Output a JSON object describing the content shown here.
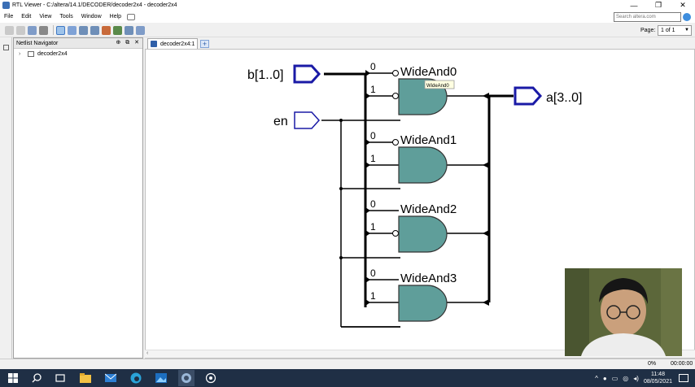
{
  "window": {
    "title": "RTL Viewer - C:/altera/14.1/DECODER/decoder2x4 - decoder2x4",
    "minimize": "—",
    "maximize": "❐",
    "close": "✕"
  },
  "menu": {
    "items": [
      "File",
      "Edit",
      "View",
      "Tools",
      "Window",
      "Help"
    ]
  },
  "search": {
    "placeholder": "Search altera.com"
  },
  "toolbar": {
    "page_label": "Page:",
    "page_value": "1 of 1"
  },
  "navigator": {
    "title": "Netlist Navigator",
    "controls": "⊕ ⧉ ✕",
    "tree": [
      {
        "label": "decoder2x4",
        "expander": "›"
      }
    ]
  },
  "tabs": [
    {
      "label": "decoder2x4:1"
    }
  ],
  "schematic": {
    "inputs": [
      {
        "label": "b[1..0]"
      },
      {
        "label": "en"
      }
    ],
    "output": {
      "label": "a[3..0]"
    },
    "gates": [
      {
        "label": "WideAnd0",
        "pin0": "0",
        "pin1": "1"
      },
      {
        "label": "WideAnd1",
        "pin0": "0",
        "pin1": "1"
      },
      {
        "label": "WideAnd2",
        "pin0": "0",
        "pin1": "1"
      },
      {
        "label": "WideAnd3",
        "pin0": "0",
        "pin1": "1"
      }
    ],
    "tooltip": "WideAnd0",
    "colors": {
      "gate_fill": "#5f9e9a",
      "port_stroke": "#1a1aa6",
      "wire": "#000000"
    }
  },
  "status": {
    "zoom": "0%",
    "time": "00:00:00"
  },
  "taskbar": {
    "clock_time": "11:48",
    "clock_date": "08/05/2021",
    "icons": [
      "windows-start-icon",
      "search-icon",
      "task-view-icon",
      "file-explorer-icon",
      "mail-icon",
      "edge-icon",
      "photos-icon",
      "quartus-icon",
      "settings-icon"
    ]
  }
}
